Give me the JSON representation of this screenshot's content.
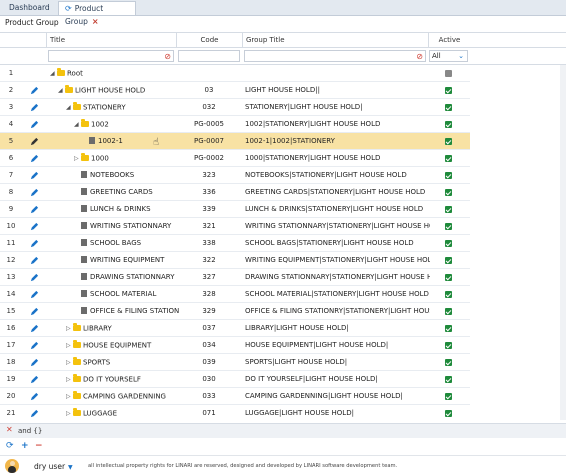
{
  "tabs": [
    {
      "label": "Dashboard"
    },
    {
      "label": "Product Group"
    }
  ],
  "page_title": "Product Group",
  "columns": {
    "title": "Title",
    "code": "Code",
    "group_title": "Group Title",
    "active": "Active"
  },
  "active_filter": "All",
  "rows": [
    {
      "n": "1",
      "title": "Root",
      "code": "",
      "group": "",
      "active": false,
      "level": 0,
      "kind": "folder-open",
      "edit": false
    },
    {
      "n": "2",
      "title": "LIGHT HOUSE HOLD",
      "code": "03",
      "group": "LIGHT HOUSE HOLD||",
      "active": true,
      "level": 1,
      "kind": "folder-open",
      "edit": true
    },
    {
      "n": "3",
      "title": "STATIONERY",
      "code": "032",
      "group": "STATIONERY|LIGHT HOUSE HOLD|",
      "active": true,
      "level": 2,
      "kind": "folder-open",
      "edit": true
    },
    {
      "n": "4",
      "title": "1002",
      "code": "PG-0005",
      "group": "1002|STATIONERY|LIGHT HOUSE HOLD",
      "active": true,
      "level": 3,
      "kind": "folder-open",
      "edit": true
    },
    {
      "n": "5",
      "title": "1002-1",
      "code": "PG-0007",
      "group": "1002-1|1002|STATIONERY",
      "active": true,
      "level": 4,
      "kind": "doc",
      "edit": true,
      "selected": true
    },
    {
      "n": "6",
      "title": "1000",
      "code": "PG-0002",
      "group": "1000|STATIONERY|LIGHT HOUSE HOLD",
      "active": true,
      "level": 3,
      "kind": "folder-closed",
      "edit": true
    },
    {
      "n": "7",
      "title": "NOTEBOOKS",
      "code": "323",
      "group": "NOTEBOOKS|STATIONERY|LIGHT HOUSE HOLD",
      "active": true,
      "level": 3,
      "kind": "doc",
      "edit": true
    },
    {
      "n": "8",
      "title": "GREETING CARDS",
      "code": "336",
      "group": "GREETING CARDS|STATIONERY|LIGHT HOUSE HOLD",
      "active": true,
      "level": 3,
      "kind": "doc",
      "edit": true
    },
    {
      "n": "9",
      "title": "LUNCH & DRINKS",
      "code": "339",
      "group": "LUNCH & DRINKS|STATIONERY|LIGHT HOUSE HOLD",
      "active": true,
      "level": 3,
      "kind": "doc",
      "edit": true
    },
    {
      "n": "10",
      "title": "WRITING STATIONNARY",
      "code": "321",
      "group": "WRITING STATIONNARY|STATIONERY|LIGHT HOUSE HOLD",
      "active": true,
      "level": 3,
      "kind": "doc",
      "edit": true
    },
    {
      "n": "11",
      "title": "SCHOOL BAGS",
      "code": "338",
      "group": "SCHOOL BAGS|STATIONERY|LIGHT HOUSE HOLD",
      "active": true,
      "level": 3,
      "kind": "doc",
      "edit": true
    },
    {
      "n": "12",
      "title": "WRITING EQUIPMENT",
      "code": "322",
      "group": "WRITING EQUIPMENT|STATIONERY|LIGHT HOUSE HOLD",
      "active": true,
      "level": 3,
      "kind": "doc",
      "edit": true
    },
    {
      "n": "13",
      "title": "DRAWING STATIONNARY",
      "code": "327",
      "group": "DRAWING STATIONNARY|STATIONERY|LIGHT HOUSE HOLD",
      "active": true,
      "level": 3,
      "kind": "doc",
      "edit": true
    },
    {
      "n": "14",
      "title": "SCHOOL MATERIAL",
      "code": "328",
      "group": "SCHOOL MATERIAL|STATIONERY|LIGHT HOUSE HOLD",
      "active": true,
      "level": 3,
      "kind": "doc",
      "edit": true
    },
    {
      "n": "15",
      "title": "OFFICE & FILING STATION",
      "code": "329",
      "group": "OFFICE & FILING STATIONRY|STATIONERY|LIGHT HOUSE HOLD",
      "active": true,
      "level": 3,
      "kind": "doc",
      "edit": true
    },
    {
      "n": "16",
      "title": "LIBRARY",
      "code": "037",
      "group": "LIBRARY|LIGHT HOUSE HOLD|",
      "active": true,
      "level": 2,
      "kind": "folder-closed",
      "edit": true
    },
    {
      "n": "17",
      "title": "HOUSE EQUIPMENT",
      "code": "034",
      "group": "HOUSE EQUIPMENT|LIGHT HOUSE HOLD|",
      "active": true,
      "level": 2,
      "kind": "folder-closed",
      "edit": true
    },
    {
      "n": "18",
      "title": "SPORTS",
      "code": "039",
      "group": "SPORTS|LIGHT HOUSE HOLD|",
      "active": true,
      "level": 2,
      "kind": "folder-closed",
      "edit": true
    },
    {
      "n": "19",
      "title": "DO IT YOURSELF",
      "code": "030",
      "group": "DO IT YOURSELF|LIGHT HOUSE HOLD|",
      "active": true,
      "level": 2,
      "kind": "folder-closed",
      "edit": true
    },
    {
      "n": "20",
      "title": "CAMPING GARDENNING",
      "code": "033",
      "group": "CAMPING GARDENNING|LIGHT HOUSE HOLD|",
      "active": true,
      "level": 2,
      "kind": "folder-closed",
      "edit": true
    },
    {
      "n": "21",
      "title": "LUGGAGE",
      "code": "071",
      "group": "LUGGAGE|LIGHT HOUSE HOLD|",
      "active": true,
      "level": 2,
      "kind": "folder-closed",
      "edit": true
    }
  ],
  "filter_expression": "and {}",
  "user_name": "dry user",
  "copyright": "all intellectual property rights for LINARI are reserved, designed and developed by LINARI software development team.",
  "colors": {
    "accent": "#1a73c8",
    "selected_row": "#f8e2a4",
    "active_check": "#1f8a3b",
    "folder": "#f4c20d"
  }
}
